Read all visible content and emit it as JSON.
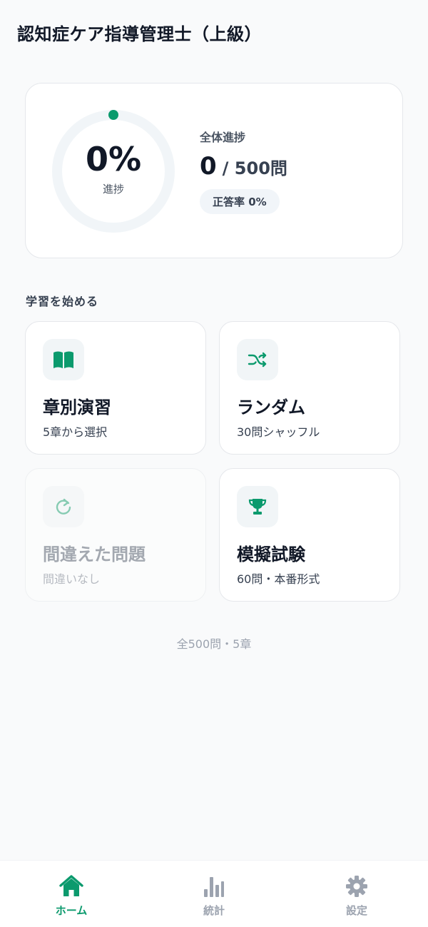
{
  "header": {
    "title": "認知症ケア指導管理士（上級）"
  },
  "progress": {
    "percent_text": "0%",
    "ring_label": "進捗",
    "overall_label": "全体進捗",
    "answered": "0",
    "total_text": "/ 500問",
    "accuracy_text": "正答率 0%",
    "progress_fraction": 0
  },
  "section_label": "学習を始める",
  "modes": [
    {
      "title": "章別演習",
      "subtitle": "5章から選択",
      "icon": "open-book-icon",
      "enabled": true
    },
    {
      "title": "ランダム",
      "subtitle": "30問シャッフル",
      "icon": "shuffle-icon",
      "enabled": true
    },
    {
      "title": "間違えた問題",
      "subtitle": "間違いなし",
      "icon": "refresh-icon",
      "enabled": false
    },
    {
      "title": "模擬試験",
      "subtitle": "60問・本番形式",
      "icon": "trophy-icon",
      "enabled": true
    }
  ],
  "footer_note": "全500問・5章",
  "nav": [
    {
      "label": "ホーム",
      "icon": "home-icon",
      "active": true
    },
    {
      "label": "統計",
      "icon": "bar-chart-icon",
      "active": false
    },
    {
      "label": "設定",
      "icon": "gear-icon",
      "active": false
    }
  ],
  "colors": {
    "accent": "#0b9a6d",
    "accent_muted": "#86cbb2",
    "nav_inactive": "#9ca3af",
    "ring_track": "#f1f5f8"
  }
}
